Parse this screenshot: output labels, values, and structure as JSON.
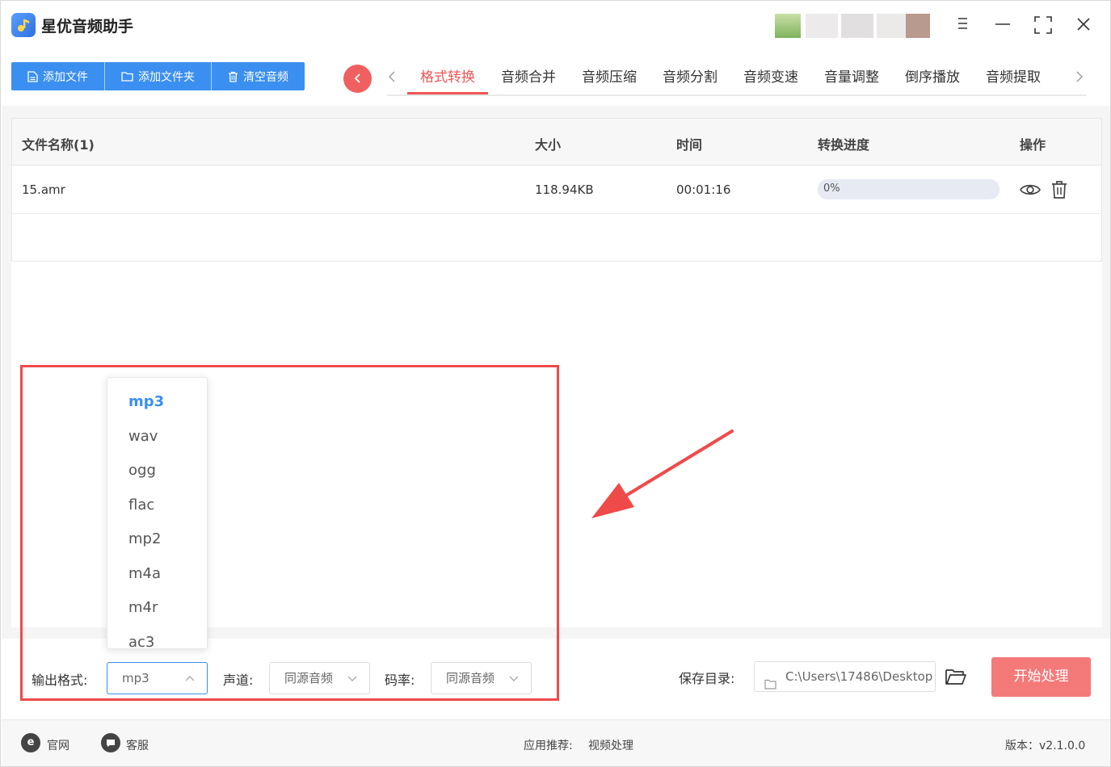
{
  "app": {
    "title": "星优音频助手"
  },
  "window_controls": {
    "menu": "menu-icon",
    "minimize": "minimize-icon",
    "maximize": "maximize-icon",
    "close": "close-icon"
  },
  "toolbar": {
    "add_file": "添加文件",
    "add_folder": "添加文件夹",
    "clear_audio": "清空音频"
  },
  "tabs": [
    {
      "label": "格式转换",
      "active": true
    },
    {
      "label": "音频合并"
    },
    {
      "label": "音频压缩"
    },
    {
      "label": "音频分割"
    },
    {
      "label": "音频变速"
    },
    {
      "label": "音量调整"
    },
    {
      "label": "倒序播放"
    },
    {
      "label": "音频提取"
    }
  ],
  "table": {
    "headers": {
      "name": "文件名称(1)",
      "size": "大小",
      "time": "时间",
      "progress": "转换进度",
      "ops": "操作"
    },
    "rows": [
      {
        "name": "15.amr",
        "size": "118.94KB",
        "time": "00:01:16",
        "progress_label": "0%",
        "progress_value": 0
      }
    ]
  },
  "settings": {
    "output_format_label": "输出格式:",
    "output_format_value": "mp3",
    "channel_label": "声道:",
    "channel_value": "同源音频",
    "bitrate_label": "码率:",
    "bitrate_value": "同源音频",
    "save_dir_label": "保存目录:",
    "save_dir_value": "C:\\Users\\17486\\Desktop",
    "start_button": "开始处理"
  },
  "format_options": [
    "mp3",
    "wav",
    "ogg",
    "flac",
    "mp2",
    "m4a",
    "m4r",
    "ac3"
  ],
  "selected_format": "mp3",
  "footer": {
    "website": "官网",
    "support": "客服",
    "recommend_label": "应用推荐:",
    "recommend_link": "视频处理",
    "version": "版本：v2.1.0.0"
  },
  "colors": {
    "accent_blue": "#3a8ff0",
    "accent_red": "#f05656",
    "start_button": "#f47a7a",
    "annotation": "#ef4a4a"
  }
}
